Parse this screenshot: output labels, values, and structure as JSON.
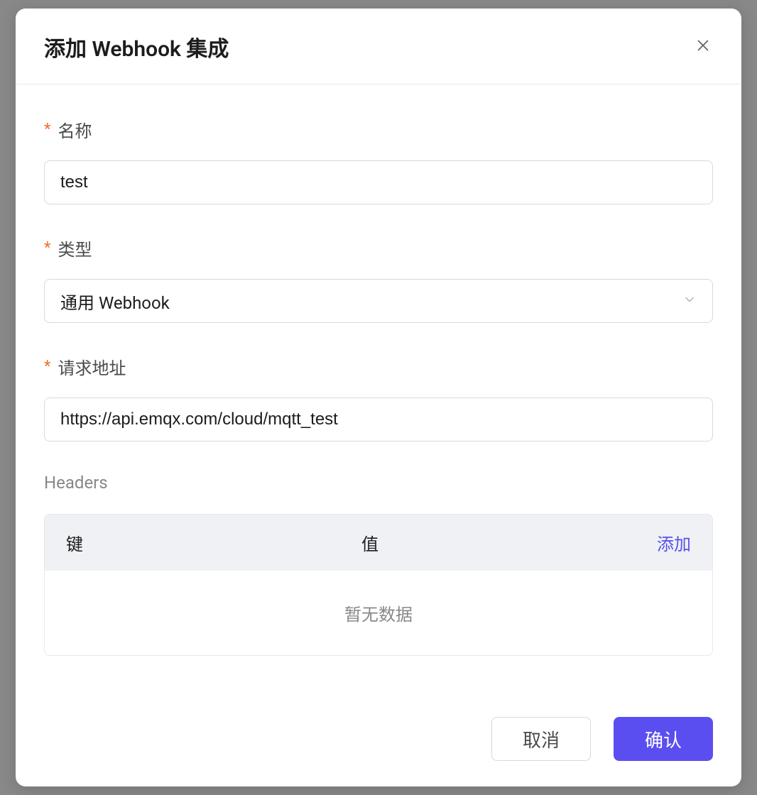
{
  "modal": {
    "title": "添加 Webhook 集成",
    "fields": {
      "name": {
        "label": "名称",
        "value": "test"
      },
      "type": {
        "label": "类型",
        "selected": "通用 Webhook"
      },
      "url": {
        "label": "请求地址",
        "value": "https://api.emqx.com/cloud/mqtt_test"
      }
    },
    "headers": {
      "section_title": "Headers",
      "key_label": "键",
      "value_label": "值",
      "add_label": "添加",
      "empty_text": "暂无数据"
    },
    "footer": {
      "cancel": "取消",
      "confirm": "确认"
    }
  }
}
